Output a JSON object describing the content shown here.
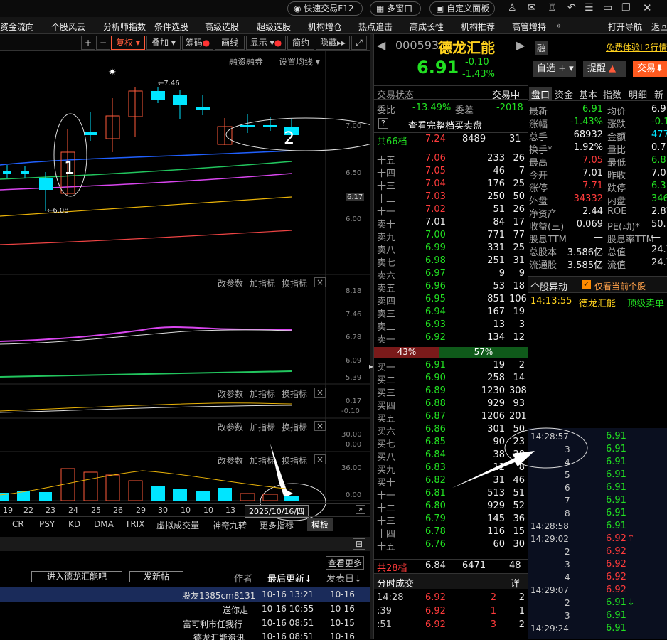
{
  "topbar": {
    "quick_trade": "快速交易F12",
    "multi_window": "多窗口",
    "custom_panel": "自定义面板"
  },
  "menu": [
    "资金流向",
    "个股风云",
    "分析师指数",
    "条件选股",
    "高级选股",
    "超级选股",
    "机构增仓",
    "热点追击",
    "高成长性",
    "机构推荐",
    "高管增持",
    "打开导航",
    "返回"
  ],
  "toolbar": {
    "restore_right": "复权",
    "overlay": "叠加",
    "chips": "筹码",
    "draw": "画线",
    "display": "显示",
    "simple": "简约",
    "hide": "隐藏"
  },
  "chart": {
    "margin_label": "融资融券",
    "set_ma": "设置均线",
    "price_labels": [
      "7.00",
      "6.50",
      "6.17",
      "6.00"
    ],
    "high_note": "7.46",
    "low_note": "6.08",
    "ann1": "1",
    "ann2": "2",
    "sub_btns": {
      "params": "改参数",
      "add": "加指标",
      "swap": "换指标",
      "close": "×"
    },
    "sub1_axis": [
      "8.18",
      "7.46",
      "6.78",
      "6.09",
      "5.39"
    ],
    "sub2_axis": [
      "0.17",
      "-0.10"
    ],
    "sub3_axis": [
      "30.00",
      "0.00"
    ],
    "vol_axis": [
      "36.00",
      "0.00"
    ],
    "dates": [
      "19",
      "22",
      "23",
      "24",
      "25",
      "26",
      "29",
      "30",
      "10",
      "10",
      "13"
    ],
    "date_tag": "2025/10/16/四",
    "tabs": [
      "CR",
      "PSY",
      "KD",
      "DMA",
      "TRIX",
      "虚拟成交量",
      "神奇九转",
      "更多指标",
      "模板"
    ]
  },
  "forum": {
    "view_more": "查看更多",
    "enter_bar": "进入德龙汇能吧",
    "new_post": "发新帖",
    "author": "作者",
    "last_update": "最后更新",
    "post_date": "发表日",
    "rows": [
      {
        "title": "股友1385cm8131",
        "update": "10-16 13:21",
        "date": "10-16"
      },
      {
        "title": "送你走",
        "update": "10-16 10:55",
        "date": "10-16"
      },
      {
        "title": "富可利市任我行",
        "update": "10-16 08:51",
        "date": "10-15"
      },
      {
        "title": "德龙汇能资讯",
        "update": "10-16 08:51",
        "date": "10-16"
      }
    ]
  },
  "stock": {
    "code": "000593",
    "name": "德龙汇能",
    "price": "6.91",
    "change": "-0.10",
    "pct": "-1.43%",
    "rong": "融"
  },
  "orderbook": {
    "trade_state_label": "交易状态",
    "trade_state": "交易中",
    "weibi_label": "委比",
    "weibi": "-13.49%",
    "weicha_label": "委差",
    "weicha": "-2018",
    "q": "?",
    "full": "查看完整档买卖盘",
    "total_sell": {
      "label": "共66档",
      "price": "7.24",
      "vol": "8489",
      "n": "31"
    },
    "sells": [
      [
        "十五",
        "7.06",
        "233",
        "26"
      ],
      [
        "十四",
        "7.05",
        "46",
        "7"
      ],
      [
        "十三",
        "7.04",
        "176",
        "25"
      ],
      [
        "十二",
        "7.03",
        "250",
        "50"
      ],
      [
        "十一",
        "7.02",
        "51",
        "26"
      ],
      [
        "卖十",
        "7.01",
        "84",
        "17"
      ],
      [
        "卖九",
        "7.00",
        "771",
        "77"
      ],
      [
        "卖八",
        "6.99",
        "331",
        "25"
      ],
      [
        "卖七",
        "6.98",
        "251",
        "31"
      ],
      [
        "卖六",
        "6.97",
        "9",
        "9"
      ],
      [
        "卖五",
        "6.96",
        "53",
        "18"
      ],
      [
        "卖四",
        "6.95",
        "851",
        "106"
      ],
      [
        "卖三",
        "6.94",
        "167",
        "19"
      ],
      [
        "卖二",
        "6.93",
        "13",
        "3"
      ],
      [
        "卖一",
        "6.92",
        "134",
        "12"
      ]
    ],
    "ratio_sell": "43%",
    "ratio_buy": "57%",
    "buys": [
      [
        "买一",
        "6.91",
        "19",
        "2"
      ],
      [
        "买二",
        "6.90",
        "258",
        "14"
      ],
      [
        "买三",
        "6.89",
        "1230",
        "308"
      ],
      [
        "买四",
        "6.88",
        "929",
        "93"
      ],
      [
        "买五",
        "6.87",
        "1206",
        "201"
      ],
      [
        "买六",
        "6.86",
        "301",
        "50"
      ],
      [
        "买七",
        "6.85",
        "90",
        "23"
      ],
      [
        "买八",
        "6.84",
        "38",
        "38"
      ],
      [
        "买九",
        "6.83",
        "12",
        "8"
      ],
      [
        "买十",
        "6.82",
        "31",
        "46"
      ],
      [
        "十一",
        "6.81",
        "513",
        "51"
      ],
      [
        "十二",
        "6.80",
        "929",
        "52"
      ],
      [
        "十三",
        "6.79",
        "145",
        "36"
      ],
      [
        "十四",
        "6.78",
        "116",
        "15"
      ],
      [
        "十五",
        "6.76",
        "60",
        "30"
      ]
    ],
    "total_buy": {
      "label": "共28档",
      "price": "6.84",
      "vol": "6471",
      "n": "48"
    },
    "ticks_label": "分时成交",
    "detail": "详",
    "ticks": [
      [
        "14:28",
        "6.92",
        "2",
        "2"
      ],
      [
        ":39",
        "6.92",
        "1",
        "1"
      ],
      [
        ":51",
        "6.92",
        "3",
        "2"
      ]
    ]
  },
  "rightpanel": {
    "promo": "免费体验L2行情",
    "watch": "自选",
    "remind": "提醒",
    "trade": "交易",
    "tabs": [
      "盘口",
      "资金",
      "基本",
      "指数",
      "明细",
      "新"
    ],
    "quote": [
      [
        "最新",
        "6.91",
        "均价",
        "6.9"
      ],
      [
        "涨幅",
        "-1.43%",
        "涨跌",
        "-0.1"
      ],
      [
        "总手",
        "68932",
        "金额",
        "4776"
      ],
      [
        "换手*",
        "1.92%",
        "量比",
        "0.7"
      ],
      [
        "最高",
        "7.05",
        "最低",
        "6.8"
      ],
      [
        "今开",
        "7.01",
        "昨收",
        "7.0"
      ],
      [
        "涨停",
        "7.71",
        "跌停",
        "6.3"
      ],
      [
        "外盘",
        "34332",
        "内盘",
        "3460"
      ],
      [
        "净资产",
        "2.44",
        "ROE",
        "2.87"
      ],
      [
        "收益(三)",
        "0.069",
        "PE(动)*",
        "50.1"
      ],
      [
        "股息TTM",
        "—",
        "股息率TTM",
        "—"
      ],
      [
        "总股本",
        "3.586亿",
        "总值",
        "24.78"
      ],
      [
        "流通股",
        "3.585亿",
        "流值",
        "24.77"
      ]
    ],
    "alert_title": "个股异动",
    "only_current": "仅看当前个股",
    "alert_time": "14:13:55",
    "alert_name": "德龙汇能",
    "alert_text": "顶级卖单",
    "ticks": [
      [
        "14:28:57",
        "6.91",
        ""
      ],
      [
        "3",
        "6.91",
        ""
      ],
      [
        "4",
        "6.91",
        ""
      ],
      [
        "5",
        "6.91",
        ""
      ],
      [
        "6",
        "6.91",
        ""
      ],
      [
        "7",
        "6.91",
        ""
      ],
      [
        "8",
        "6.91",
        ""
      ],
      [
        "14:28:58",
        "6.91",
        ""
      ],
      [
        "14:29:02",
        "6.92",
        "↑"
      ],
      [
        "2",
        "6.92",
        ""
      ],
      [
        "3",
        "6.92",
        ""
      ],
      [
        "4",
        "6.92",
        ""
      ],
      [
        "14:29:07",
        "6.92",
        ""
      ],
      [
        "2",
        "6.91",
        "↓"
      ],
      [
        "3",
        "6.91",
        ""
      ],
      [
        "14:29:24",
        "6.91",
        ""
      ]
    ]
  }
}
